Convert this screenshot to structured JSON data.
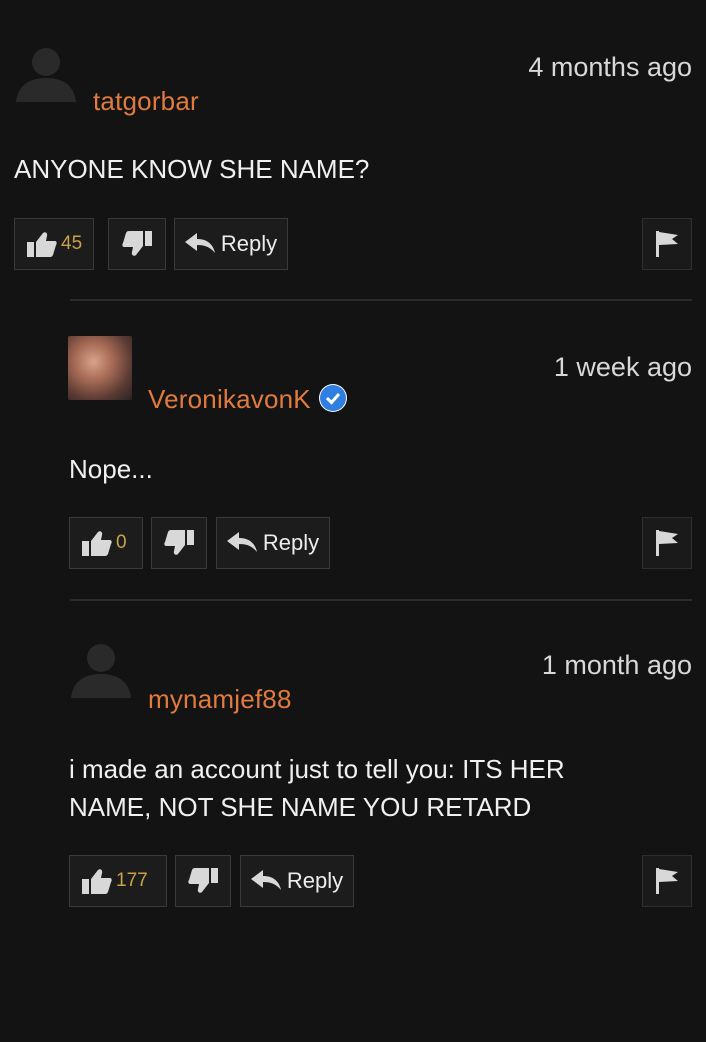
{
  "comments": [
    {
      "username": "tatgorbar",
      "timestamp": "4 months ago",
      "text_lines": [
        "ANYONE KNOW SHE NAME?"
      ],
      "likes": "45",
      "reply_label": "Reply",
      "verified": false,
      "avatar": "default-user-icon"
    },
    {
      "username": "VeronikavonK",
      "timestamp": "1 week ago",
      "text_lines": [
        "Nope..."
      ],
      "likes": "0",
      "reply_label": "Reply",
      "verified": true,
      "avatar": "profile-photo"
    },
    {
      "username": "mynamjef88",
      "timestamp": "1 month ago",
      "text_lines": [
        "i made an account just to tell you: ITS HER",
        "NAME, NOT SHE NAME YOU RETARD"
      ],
      "likes": "177",
      "reply_label": "Reply",
      "verified": false,
      "avatar": "default-user-icon"
    }
  ],
  "colors": {
    "background": "#131313",
    "username": "#e07a3f",
    "like_count": "#c9a248",
    "verified_badge": "#2f7fe0"
  }
}
